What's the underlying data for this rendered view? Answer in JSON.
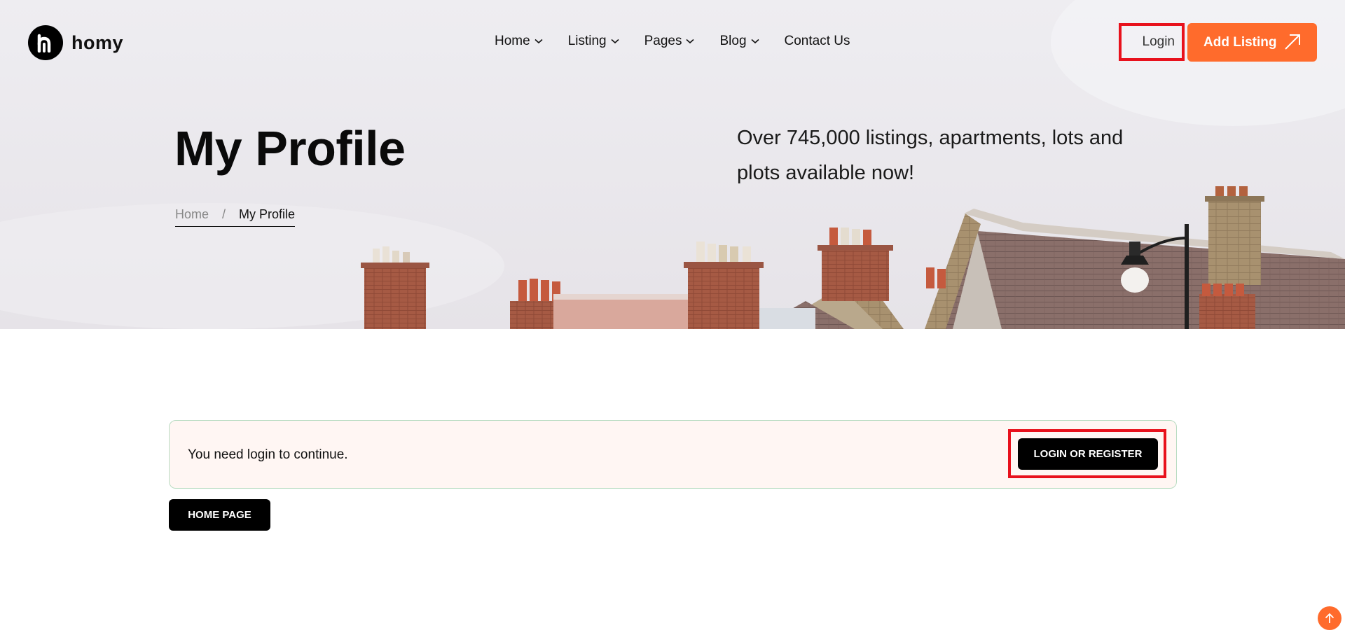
{
  "brand": {
    "name": "homy",
    "logo_icon": "homy-logo-icon"
  },
  "nav": {
    "items": [
      {
        "label": "Home",
        "has_dropdown": true
      },
      {
        "label": "Listing",
        "has_dropdown": true
      },
      {
        "label": "Pages",
        "has_dropdown": true
      },
      {
        "label": "Blog",
        "has_dropdown": true
      },
      {
        "label": "Contact Us",
        "has_dropdown": false
      }
    ],
    "login_label": "Login",
    "add_listing_label": "Add Listing"
  },
  "hero": {
    "title": "My Profile",
    "tagline": "Over 745,000 listings, apartments, lots and plots available now!",
    "breadcrumb": {
      "home": "Home",
      "separator": "/",
      "current": "My Profile"
    }
  },
  "notice": {
    "message": "You need login to continue.",
    "button_label": "LOGIN OR REGISTER"
  },
  "home_page_button": "HOME PAGE",
  "colors": {
    "accent": "#ff6b2c",
    "highlight_frame": "#e8111c",
    "notice_bg": "#fff6f3",
    "notice_border": "#b9dcc2"
  }
}
